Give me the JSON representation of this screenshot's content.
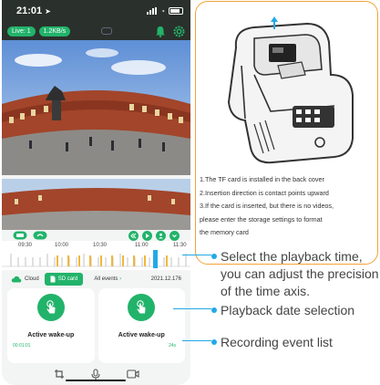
{
  "status_bar": {
    "time": "21:01"
  },
  "top_bar": {
    "live_label": "Live: 1",
    "rate_label": "1.2KB/s"
  },
  "timeline": {
    "ticks": [
      "09:30",
      "10:00",
      "10:30",
      "11:00",
      "11:30"
    ]
  },
  "tabs": {
    "cloud": "Cloud",
    "sd_card": "SD card",
    "all_events": "All events",
    "date": "2021.12.176"
  },
  "events": [
    {
      "title": "Active wake-up",
      "time": "00:01:01"
    },
    {
      "title": "Active wake-up",
      "time": "24s"
    }
  ],
  "info_panel": {
    "lines": [
      "1.The TF card is installed in the back cover",
      "2.Insertion direction is contact points upward",
      "3.If the card is inserted, but there is no videos,",
      "please enter the storage settings to format",
      "the memory card"
    ]
  },
  "callouts": {
    "playback_time": [
      "Select the playback time,",
      "you can adjust the precision",
      "of the time axis."
    ],
    "playback_date": "Playback date selection",
    "event_list": "Recording event list"
  },
  "colors": {
    "accent_green": "#22b36a",
    "callout_blue": "#22a9e6",
    "panel_border": "#f2a338"
  }
}
